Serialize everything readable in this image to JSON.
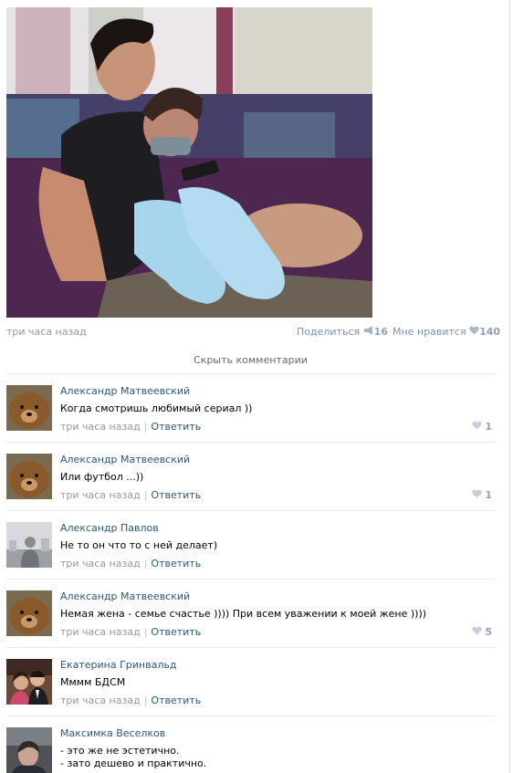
{
  "post": {
    "time": "три часа назад",
    "share_label": "Поделиться",
    "share_count": "16",
    "like_label": "Мне нравится",
    "like_count": "140"
  },
  "comments_toggle": "Скрыть комментарии",
  "comments": [
    {
      "author": "Александр Матвеевский",
      "lines": [
        "Когда смотришь любимый сериал ))"
      ],
      "time": "три часа назад",
      "reply": "Ответить",
      "likes": "1"
    },
    {
      "author": "Александр Матвеевский",
      "lines": [
        "Или футбол ...))"
      ],
      "time": "три часа назад",
      "reply": "Ответить",
      "likes": "1"
    },
    {
      "author": "Александр Павлов",
      "lines": [
        "Не то он что то с ней делает)"
      ],
      "time": "три часа назад",
      "reply": "Ответить",
      "likes": ""
    },
    {
      "author": "Александр Матвеевский",
      "lines": [
        "Немая жена - семье счастье )))) При всем уважении к моей жене ))))"
      ],
      "time": "три часа назад",
      "reply": "Ответить",
      "likes": "5"
    },
    {
      "author": "Екатерина Гринвальд",
      "lines": [
        "Мммм БДСМ"
      ],
      "time": "три часа назад",
      "reply": "Ответить",
      "likes": ""
    },
    {
      "author": "Максимка Веселков",
      "lines": [
        "- это же не эстетично.",
        "- зато дешево и практично."
      ],
      "time": "",
      "reply": "",
      "likes": ""
    }
  ],
  "colors": {
    "link": "#2b587a",
    "muted": "#999999",
    "like": "#8ea0b5",
    "divider": "#e7eaed"
  },
  "icons": {
    "share": "megaphone-icon",
    "like": "heart-icon"
  }
}
